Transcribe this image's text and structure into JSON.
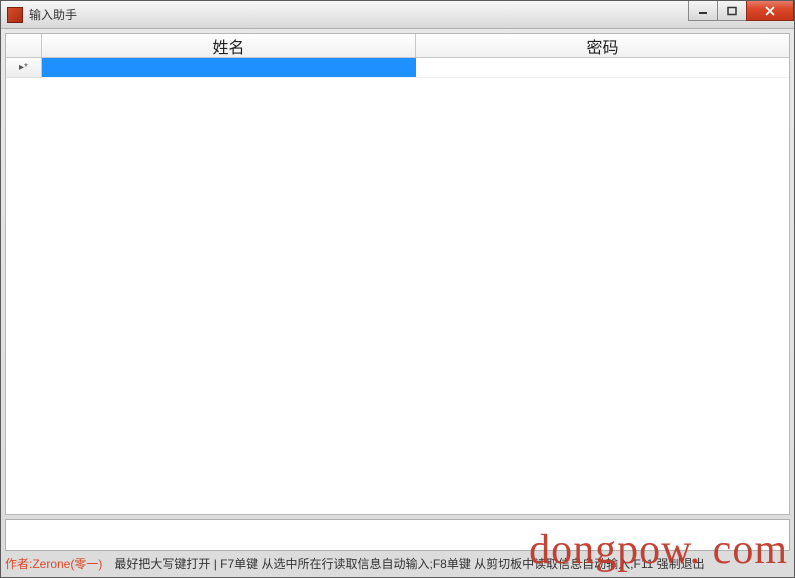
{
  "window": {
    "title": "输入助手"
  },
  "grid": {
    "columns": [
      "姓名",
      "密码"
    ],
    "row_indicator": "▸*",
    "rows": [
      {
        "selected_col": 0,
        "cells": [
          "",
          ""
        ]
      }
    ]
  },
  "input_bar": {
    "value": ""
  },
  "status": {
    "author": "作者:Zerone(零一)",
    "hint": "最好把大写键打开 | F7单键 从选中所在行读取信息自动输入;F8单键 从剪切板中读取信息自动输入;F11 强制退出"
  },
  "watermark": "dongpow. com"
}
